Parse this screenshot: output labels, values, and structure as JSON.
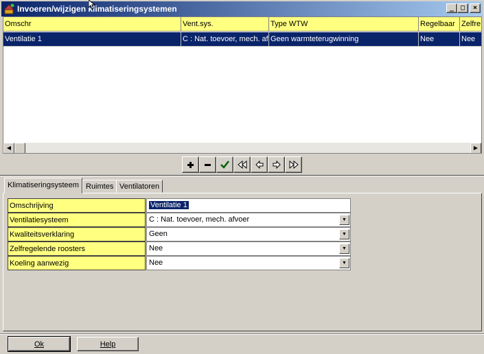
{
  "window": {
    "title": "Invoeren/wijzigen klimatiseringsystemen",
    "controls": {
      "minimize": "_",
      "maximize": "□",
      "close": "×"
    }
  },
  "grid": {
    "columns": [
      "Omschr",
      "Vent.sys.",
      "Type WTW",
      "Regelbaar",
      "Zelfre"
    ],
    "rows": [
      [
        "Ventilatie 1",
        "C : Nat. toevoer, mech. afv",
        "Geen warmteterugwinning",
        "Nee",
        "Nee"
      ]
    ]
  },
  "navigator": {
    "buttons": [
      "plus-icon",
      "minus-icon",
      "check-icon",
      "first-icon",
      "prior-icon",
      "next-icon",
      "last-icon"
    ]
  },
  "tabs": [
    "Klimatiseringsysteem",
    "Ruimtes",
    "Ventilatoren"
  ],
  "active_tab": "Klimatiseringsysteem",
  "form": {
    "fields": [
      {
        "label": "Omschrijving",
        "value": "Ventilatie 1",
        "type": "text"
      },
      {
        "label": "Ventilatiesysteem",
        "value": "C : Nat. toevoer, mech. afvoer",
        "type": "select"
      },
      {
        "label": "Kwaliteitsverklaring",
        "value": "Geen",
        "type": "select"
      },
      {
        "label": "Zelfregelende roosters",
        "value": "Nee",
        "type": "select"
      },
      {
        "label": "Koeling aanwezig",
        "value": "Nee",
        "type": "select"
      }
    ]
  },
  "buttons": {
    "ok": "Ok",
    "help": "Help"
  },
  "colors": {
    "title_bar": "#0a246a",
    "header_bg": "#ffff80",
    "selection": "#0a246a",
    "face": "#d4d0c8"
  }
}
